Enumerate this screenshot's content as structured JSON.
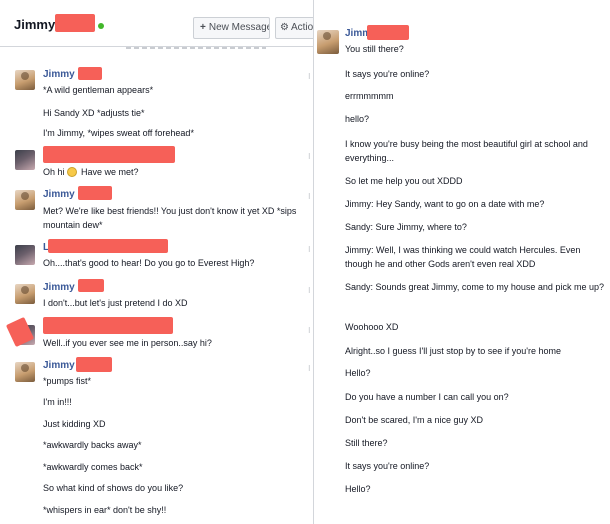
{
  "header": {
    "name": "Jimmy",
    "new_message_label": "New Message",
    "actions_label": "Actio"
  },
  "left_messages": [
    {
      "sender": "Jimmy",
      "lines": [
        "*A wild gentleman appears*",
        "Hi Sandy XD *adjusts tie*",
        "I'm Jimmy, *wipes sweat off forehead*"
      ]
    },
    {
      "sender": "",
      "lines": [
        "Oh hi",
        "Have we met?"
      ]
    },
    {
      "sender": "Jimmy",
      "lines": [
        "Met? We're like best friends!! You just don't know it yet XD *sips mountain dew*"
      ]
    },
    {
      "sender": "L",
      "lines": [
        "Oh....that's good to hear! Do you go to Everest High?"
      ]
    },
    {
      "sender": "Jimmy",
      "lines": [
        "I don't...but let's just pretend I do XD"
      ]
    },
    {
      "sender": "",
      "lines": [
        "Well..if you ever see me in person..say hi?"
      ]
    },
    {
      "sender": "Jimmy",
      "lines": [
        "*pumps fist*",
        "I'm in!!!",
        "Just kidding XD",
        "*awkwardly backs away*",
        "*awkwardly comes back*",
        "So what kind of shows do you like?",
        "*whispers in ear* don't be shy!!"
      ]
    }
  ],
  "right_thread": {
    "sender": "Jimmy",
    "lines": [
      "You still there?",
      "It says you're online?",
      "errmmmmm",
      "hello?",
      "I know you're busy being the most beautiful girl at school and everything...",
      "So let me help you out XDDD",
      "Jimmy:  Hey Sandy, want to go on a date with me?",
      "Sandy:  Sure Jimmy, where to?",
      "Jimmy:  Well, I was thinking we could watch Hercules.  Even though he and other Gods aren't even real XDD",
      "Sandy:  Sounds great Jimmy, come to my house and pick me up?",
      "Woohooo XD",
      "Alright..so I guess I'll just stop by to see if you're home",
      "Hello?",
      "Do you have a number I can call you on?",
      "Don't be scared, I'm a nice guy XD",
      "Still there?",
      "It says you're online?",
      "Hello?"
    ]
  },
  "colors": {
    "name_blue": "#3b5998",
    "online_green": "#42b72a",
    "redaction": "#f66058"
  }
}
